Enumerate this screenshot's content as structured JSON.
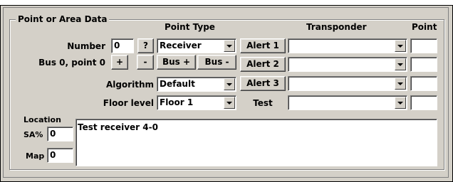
{
  "group_title": "Point or Area Data",
  "headers": {
    "point_type": "Point Type",
    "transponder": "Transponder",
    "point": "Point"
  },
  "number": {
    "label": "Number",
    "value": "0",
    "help_label": "?"
  },
  "bus": {
    "label": "Bus 0, point 0",
    "plus_label": "+",
    "minus_label": "-"
  },
  "point_type": {
    "selected": "Receiver"
  },
  "bus_buttons": {
    "plus_label": "Bus +",
    "minus_label": "Bus -"
  },
  "algorithm": {
    "label": "Algorithm",
    "selected": "Default"
  },
  "floor_level": {
    "label": "Floor level",
    "selected": "Floor 1"
  },
  "alerts": [
    {
      "label": "Alert 1",
      "transponder": "",
      "point": ""
    },
    {
      "label": "Alert 2",
      "transponder": "",
      "point": ""
    },
    {
      "label": "Alert 3",
      "transponder": "",
      "point": ""
    }
  ],
  "test": {
    "label": "Test",
    "transponder": "",
    "point": ""
  },
  "location": {
    "label": "Location",
    "text": "Test receiver 4-0"
  },
  "sa": {
    "label": "SA%",
    "value": "0"
  },
  "map": {
    "label": "Map",
    "value": "0"
  }
}
